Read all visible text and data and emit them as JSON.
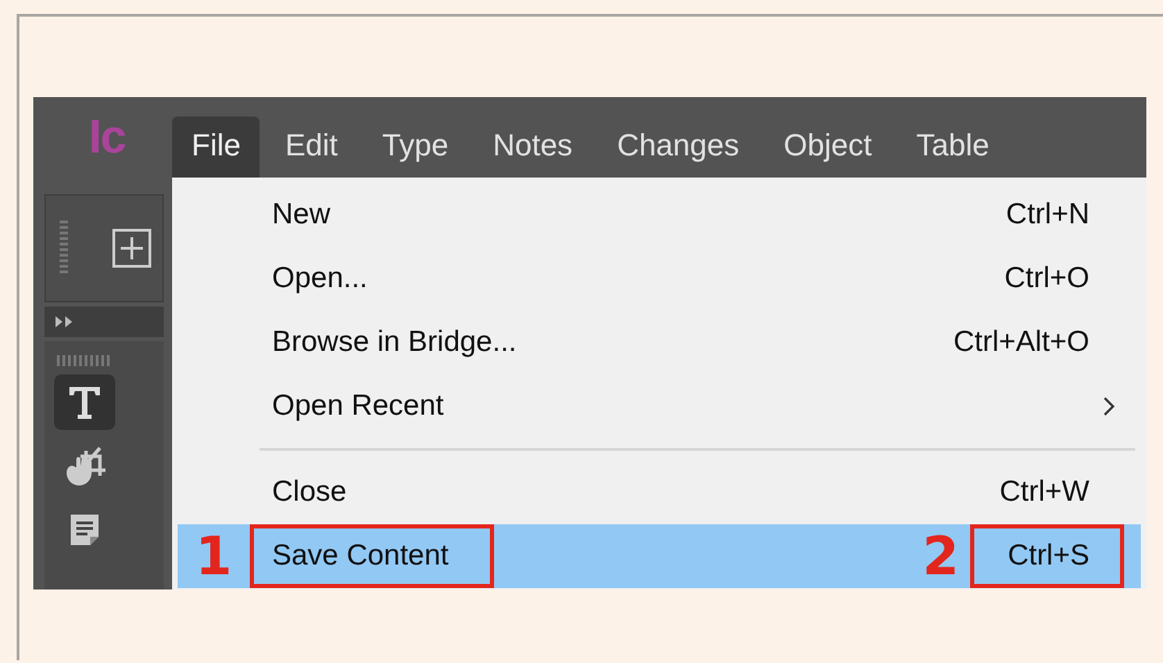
{
  "app": {
    "logo": "Ic"
  },
  "menu_bar": [
    {
      "label": "File",
      "selected": true
    },
    {
      "label": "Edit",
      "selected": false
    },
    {
      "label": "Type",
      "selected": false
    },
    {
      "label": "Notes",
      "selected": false
    },
    {
      "label": "Changes",
      "selected": false
    },
    {
      "label": "Object",
      "selected": false
    },
    {
      "label": "Table",
      "selected": false
    }
  ],
  "tools": [
    {
      "kind": "type",
      "selected": true
    },
    {
      "kind": "crop",
      "selected": false
    },
    {
      "kind": "note",
      "selected": false
    }
  ],
  "file_menu": [
    {
      "kind": "command",
      "label": "New",
      "shortcut": "Ctrl+N",
      "selected": false
    },
    {
      "kind": "command",
      "label": "Open...",
      "shortcut": "Ctrl+O",
      "selected": false
    },
    {
      "kind": "command",
      "label": "Browse in Bridge...",
      "shortcut": "Ctrl+Alt+O",
      "selected": false
    },
    {
      "kind": "submenu",
      "label": "Open Recent",
      "selected": false
    },
    {
      "kind": "separator"
    },
    {
      "kind": "command",
      "label": "Close",
      "shortcut": "Ctrl+W",
      "selected": false
    },
    {
      "kind": "command",
      "label": "Save Content",
      "shortcut": "Ctrl+S",
      "selected": true,
      "callouts": {
        "label": "1",
        "shortcut": "2"
      }
    }
  ]
}
